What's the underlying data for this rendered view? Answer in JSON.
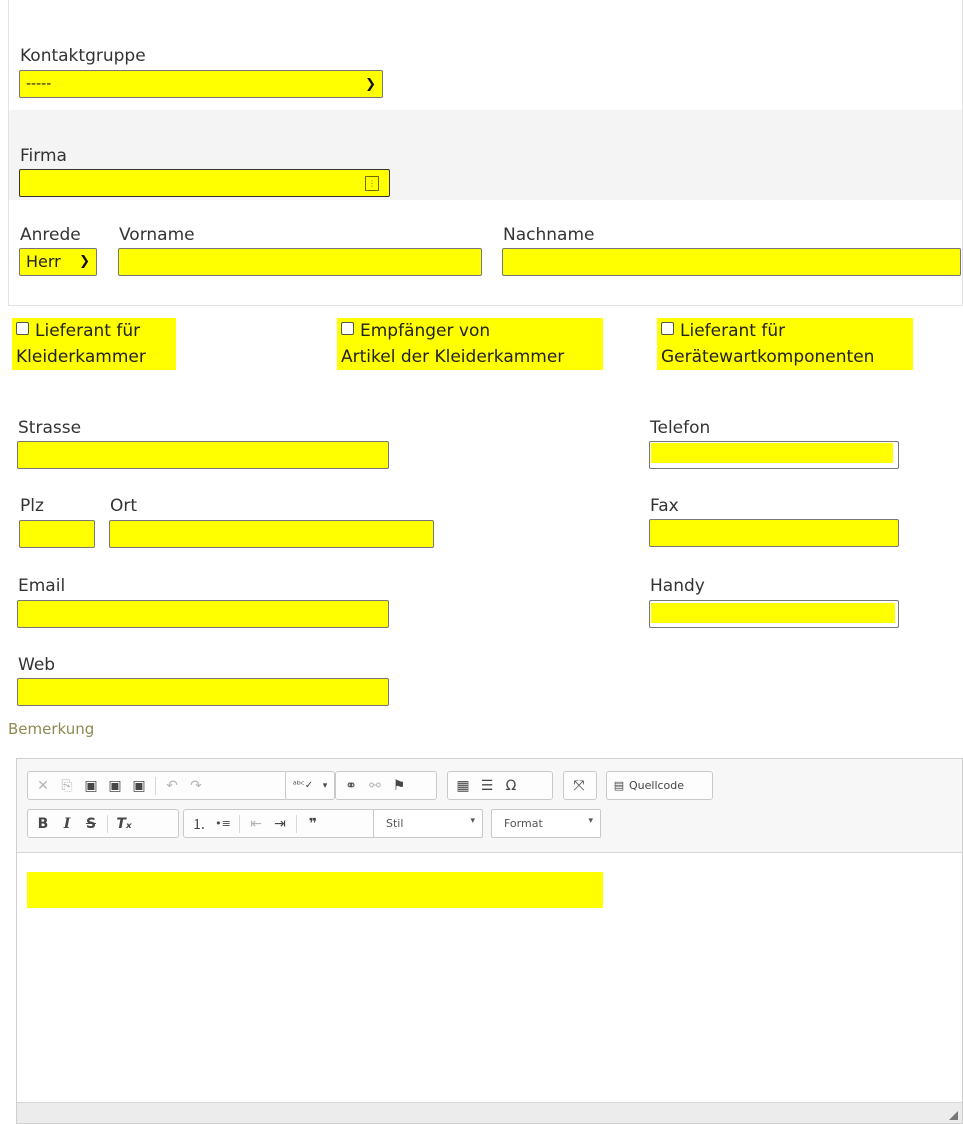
{
  "form": {
    "kontaktgruppe": {
      "label": "Kontaktgruppe",
      "value": "-----"
    },
    "firma": {
      "label": "Firma",
      "value": ""
    },
    "anrede": {
      "label": "Anrede",
      "value": "Herr"
    },
    "vorname": {
      "label": "Vorname",
      "value": ""
    },
    "nachname": {
      "label": "Nachname",
      "value": ""
    },
    "checkboxes": [
      {
        "line1": "Lieferant für",
        "line2": "Kleiderkammer",
        "checked": false
      },
      {
        "line1": "Empfänger von",
        "line2": "Artikel der Kleiderkammer",
        "checked": false
      },
      {
        "line1": "Lieferant für",
        "line2": "Gerätewartkomponenten",
        "checked": false
      }
    ],
    "strasse": {
      "label": "Strasse",
      "value": ""
    },
    "plz": {
      "label": "Plz",
      "value": ""
    },
    "ort": {
      "label": "Ort",
      "value": ""
    },
    "email": {
      "label": "Email",
      "value": ""
    },
    "web": {
      "label": "Web",
      "value": ""
    },
    "telefon": {
      "label": "Telefon",
      "value": ""
    },
    "fax": {
      "label": "Fax",
      "value": ""
    },
    "handy": {
      "label": "Handy",
      "value": ""
    },
    "bemerkung": {
      "label": "Bemerkung"
    }
  },
  "editor": {
    "source_label": "Quellcode",
    "style_combo": "Stil",
    "format_combo": "Format",
    "icons": {
      "cut": "✕",
      "copy": "⎘",
      "paste": "▣",
      "paste_text": "▣",
      "paste_word": "▣",
      "undo": "↶",
      "redo": "↷",
      "spellcheck": "ᵃᵇᶜ✓",
      "link": "⚭",
      "unlink": "⚯",
      "anchor": "⚑",
      "table": "▦",
      "hline": "☰",
      "special_char": "Ω",
      "maximize": "⤧",
      "source": "▤",
      "bold": "B",
      "italic": "I",
      "strike": "S",
      "remove_format": "Tₓ",
      "numbered_list": "⒈",
      "bulleted_list": "•≡",
      "outdent": "⇤",
      "indent": "⇥",
      "blockquote": "❞",
      "dropdown": "▾"
    }
  },
  "colors": {
    "highlight": "#ffff00",
    "label_olive": "#8f8a52"
  }
}
